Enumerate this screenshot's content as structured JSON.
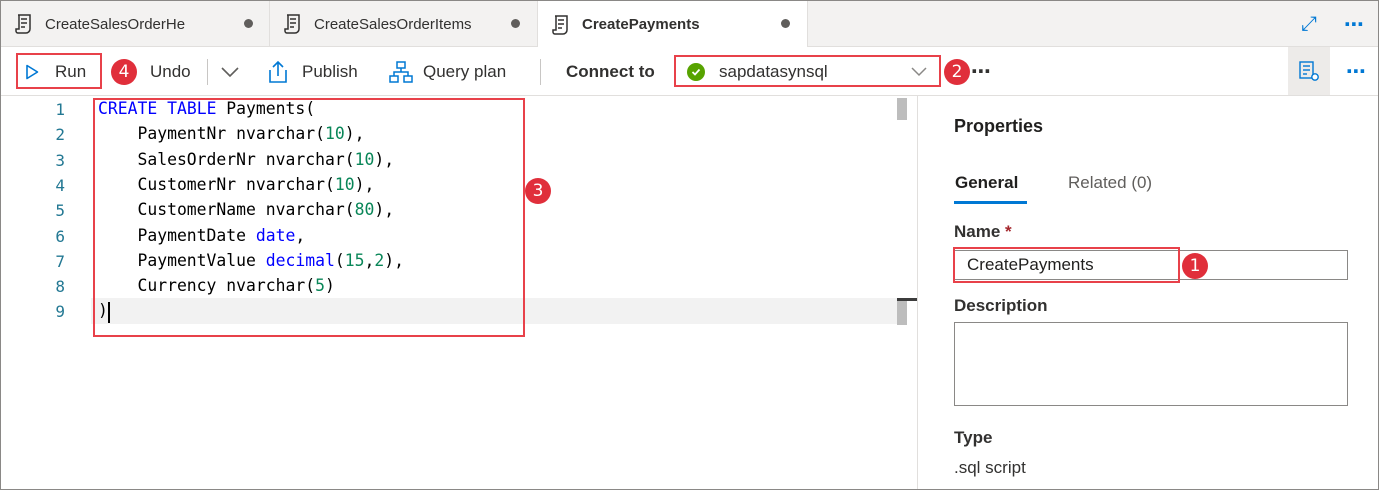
{
  "tabs": [
    {
      "label": "CreateSalesOrderHe",
      "icon": "script-icon",
      "modified": true,
      "active": false
    },
    {
      "label": "CreateSalesOrderItems",
      "icon": "script-icon",
      "modified": true,
      "active": false
    },
    {
      "label": "CreatePayments",
      "icon": "script-icon",
      "modified": true,
      "active": true
    }
  ],
  "tab_actions": {
    "expand": "⤢",
    "more": "⋯"
  },
  "toolbar": {
    "run_label": "Run",
    "undo_label": "Undo",
    "publish_label": "Publish",
    "query_plan_label": "Query plan",
    "connect_to_label": "Connect to",
    "connection_value": "sapdatasynsql",
    "more": "⋯",
    "panel_more": "⋯"
  },
  "badges": {
    "run": "4",
    "connection": "2",
    "code": "3",
    "name": "1"
  },
  "editor": {
    "line_numbers": [
      "1",
      "2",
      "3",
      "4",
      "5",
      "6",
      "7",
      "8",
      "9"
    ],
    "lines": [
      [
        {
          "t": "CREATE",
          "c": "kw"
        },
        {
          "t": " "
        },
        {
          "t": "TABLE",
          "c": "kw"
        },
        {
          "t": " Payments("
        }
      ],
      [
        {
          "t": "    PaymentNr nvarchar("
        },
        {
          "t": "10",
          "c": "num"
        },
        {
          "t": "),"
        }
      ],
      [
        {
          "t": "    SalesOrderNr nvarchar("
        },
        {
          "t": "10",
          "c": "num"
        },
        {
          "t": "),"
        }
      ],
      [
        {
          "t": "    CustomerNr nvarchar("
        },
        {
          "t": "10",
          "c": "num"
        },
        {
          "t": "),"
        }
      ],
      [
        {
          "t": "    CustomerName nvarchar("
        },
        {
          "t": "80",
          "c": "num"
        },
        {
          "t": "),"
        }
      ],
      [
        {
          "t": "    PaymentDate "
        },
        {
          "t": "date",
          "c": "kw"
        },
        {
          "t": ","
        }
      ],
      [
        {
          "t": "    PaymentValue "
        },
        {
          "t": "decimal",
          "c": "kw"
        },
        {
          "t": "("
        },
        {
          "t": "15",
          "c": "num"
        },
        {
          "t": ","
        },
        {
          "t": "2",
          "c": "num"
        },
        {
          "t": "),"
        }
      ],
      [
        {
          "t": "    Currency nvarchar("
        },
        {
          "t": "5",
          "c": "num"
        },
        {
          "t": ")"
        }
      ],
      [
        {
          "t": ")"
        }
      ]
    ]
  },
  "properties": {
    "title": "Properties",
    "tabs": [
      "General",
      "Related (0)"
    ],
    "name_label": "Name",
    "required_mark": "*",
    "name_value": "CreatePayments",
    "description_label": "Description",
    "description_value": "",
    "type_label": "Type",
    "type_value": ".sql script"
  },
  "colors": {
    "accent": "#0078d4",
    "annotation_red": "#e02f3b",
    "connected_green": "#57a300"
  }
}
